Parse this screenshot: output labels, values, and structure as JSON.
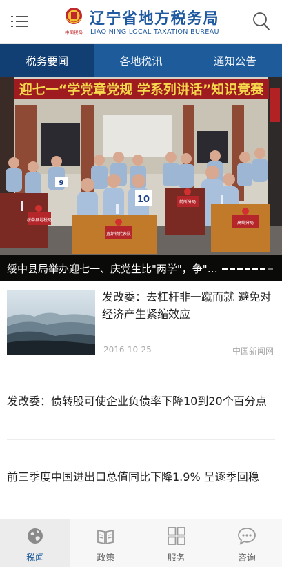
{
  "header": {
    "title_cn": "辽宁省地方税务局",
    "title_en": "LIAO NING LOCAL TAXATION BUREAU",
    "emblem_text": "中国税务",
    "icons": {
      "menu": "menu-icon",
      "search": "search-icon",
      "emblem": "tax-emblem-icon"
    }
  },
  "tabs": [
    {
      "label": "税务要闻",
      "active": true
    },
    {
      "label": "各地税讯",
      "active": false
    },
    {
      "label": "通知公告",
      "active": false
    }
  ],
  "hero": {
    "banner_text": "迎七一“学党章党规 学系列讲话”知识竞赛",
    "desk_plaques": [
      "绥中县地税局",
      "前所分局",
      "宽邦镇代表队",
      "高岭分局"
    ],
    "numbers": [
      "9",
      "10"
    ],
    "caption": "绥中县局举办迎七一、庆党生比\"两学\"，争\"一...",
    "slide_count": 7,
    "active_slide": 1
  },
  "news": [
    {
      "title": "发改委：去杠杆非一蹴而就 避免对经济产生紧缩效应",
      "date": "2016-10-25",
      "source": "中国新闻网",
      "has_thumb": true
    },
    {
      "title": "发改委：债转股可使企业负债率下降10到20个百分点"
    },
    {
      "title": "前三季度中国进出口总值同比下降1.9% 呈逐季回稳"
    }
  ],
  "bottom_nav": [
    {
      "label": "税闻",
      "icon": "globe-icon",
      "active": true
    },
    {
      "label": "政策",
      "icon": "book-icon",
      "active": false
    },
    {
      "label": "服务",
      "icon": "grid-icon",
      "active": false
    },
    {
      "label": "咨询",
      "icon": "chat-bubble-icon",
      "active": false
    }
  ],
  "colors": {
    "brand_blue": "#1f5aa0",
    "tab_bar": "#1e5b9a",
    "tab_active": "#123f73",
    "banner_red": "#c0282d"
  }
}
